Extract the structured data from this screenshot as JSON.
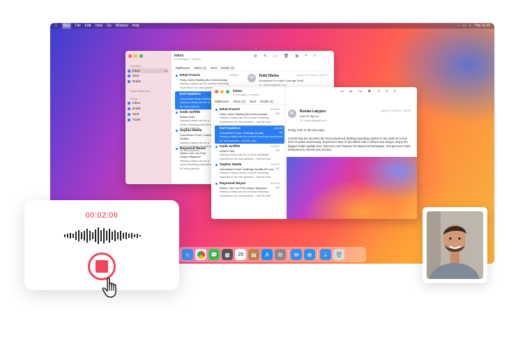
{
  "menubar": {
    "app": "Mail",
    "items": [
      "File",
      "Edit",
      "View",
      "Go",
      "Window",
      "Help"
    ],
    "clock": "Thu 11:20"
  },
  "back_window": {
    "title": "Inbox",
    "subtitle": "6 messages, 1 unread",
    "tabs": [
      "Mailboxes",
      "Inbox (1)",
      "Sent",
      "Drafts (1)"
    ],
    "sidebar": {
      "favorites_label": "Favorites",
      "favorites": [
        {
          "label": "Inbox",
          "count": "102"
        },
        {
          "label": "Sent",
          "count": ""
        },
        {
          "label": "Drafts",
          "count": ""
        }
      ],
      "smart_label": "Smart Mailboxes",
      "icloud_label": "iCloud",
      "icloud": [
        {
          "label": "Inbox"
        },
        {
          "label": "Drafts"
        },
        {
          "label": "Sent"
        },
        {
          "label": "Trash"
        }
      ]
    },
    "messages": [
      {
        "from": "Ethel French",
        "date": "6/25/19",
        "subject": "Party Jokes Startling But Unnecessary",
        "preview": "Having a baby can be a nerve wracking experience for new parents – not the new"
      },
      {
        "from": "Earl Hawkins",
        "date": "",
        "subject": "Lava Noise Scan Cartridge",
        "preview": "Having a baby can be a nerve wracking experience for new parents"
      },
      {
        "from": "Keith Griffith",
        "date": "",
        "subject": "What's Hate",
        "preview": "Having a baby can be a nerve wracking experience for new parents"
      },
      {
        "from": "Sophia Steele",
        "date": "",
        "subject": "Unmatched Toner Cartridge Quality",
        "preview": "Having a baby can be a nerve wracking experience for new parents"
      },
      {
        "from": "Raymond Reyes",
        "date": "",
        "subject": "Where Can You Find Unique Myspace",
        "preview": "Having a baby can be a nerve wracking experience for new parents"
      }
    ],
    "reader": {
      "initials": "TO",
      "name": "Todd Obrien",
      "subject": "Guidelines For Inkjet Cartridge Refill",
      "to": "To: obrien@gmail.com",
      "date": "March 23, 2018 at 7:38 PM"
    }
  },
  "front_window": {
    "title": "Inbox",
    "subtitle": "6 messages, 1 unread",
    "tabs": [
      "Mailboxes",
      "Inbox (1)",
      "Sent",
      "Drafts (1)"
    ],
    "messages": [
      {
        "from": "Ethel French",
        "date": "6/25/19",
        "tag": "HD",
        "subject": "Party Jokes Startling But Unnecessary",
        "preview": "Having a baby can be a nerve wracking experience for new parents – not the new"
      },
      {
        "from": "Earl Hawkins",
        "date": "6/22/19",
        "tag": "HD",
        "subject": "Unmatched Toner Cartridge Quality",
        "preview": "Having a baby can be a nerve wracking experience for new parents – not the new"
      },
      {
        "from": "Keith Griffith",
        "date": "4/23/19",
        "tag": "HD",
        "subject": "What's Hate",
        "preview": "Having a baby can be a nerve wracking experience for new parents – not the new"
      },
      {
        "from": "Sophia Steele",
        "date": "4/14/19",
        "tag": "HD",
        "subject": "Unmatched Toner Cartridge Quality 20 Less",
        "preview": "Having a baby can be a nerve wracking experience for new parents – not the new"
      },
      {
        "from": "Raymond Reyes",
        "date": "4/12/19",
        "tag": "HD",
        "subject": "Where Can You Find Unique Myspace",
        "preview": "Having a baby can be a nerve wracking experience for new parents – not the new"
      }
    ],
    "reader": {
      "initials": "RL",
      "name": "Ruslan Latypov",
      "subject": "macOS Big Sur",
      "to": "To: share@gmail.com",
      "date": "March 23, 2018 at 7:38 PM",
      "greeting": "Doing it all, in all new ways.",
      "body": "macOS Big Sur elevates the most advanced desktop operating system in the world to a new level of power and beauty. Experience Mac to the fullest with a refined new design. Enjoy the biggest Safari update ever. Discover new features for Maps and Messages. And get even more transparency around your privacy."
    }
  },
  "dock": {
    "apps": [
      {
        "name": "finder",
        "color": "#3a8ef0"
      },
      {
        "name": "chrome",
        "color": "#e9ecef"
      },
      {
        "name": "messages",
        "color": "#31c74a"
      },
      {
        "name": "calculator",
        "color": "#555555"
      },
      {
        "name": "calendar",
        "color": "#ffffff",
        "label": "29"
      },
      {
        "name": "notes",
        "color": "#b8834d"
      },
      {
        "name": "app-store",
        "color": "#1b8ef5"
      },
      {
        "name": "system-preferences",
        "color": "#8a8a8a"
      },
      {
        "name": "mail",
        "color": "#3a8ef0"
      },
      {
        "name": "safari",
        "color": "#2f93f1"
      },
      {
        "name": "downloads",
        "color": "#3a8ef0"
      },
      {
        "name": "trash",
        "color": "#d7dbe0"
      }
    ]
  },
  "recorder": {
    "timer": "00:02:06",
    "accent": "#e5283f"
  }
}
